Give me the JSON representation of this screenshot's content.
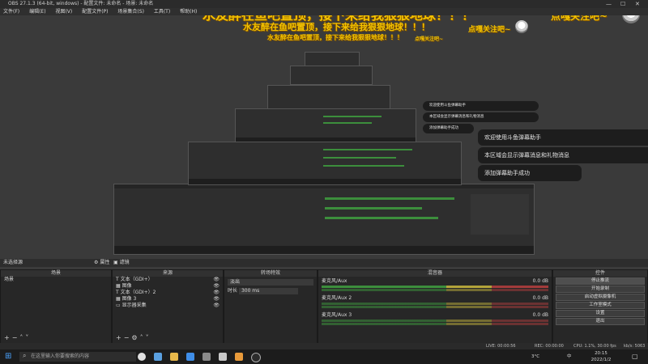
{
  "window": {
    "title": "OBS 27.1.3 (64-bit, windows) - 配置文件: 未命名 - 场景: 未命名",
    "minimize_glyph": "—",
    "maximize_glyph": "☐",
    "close_glyph": "✕"
  },
  "menu": [
    "文件(F)",
    "编辑(E)",
    "视图(V)",
    "配置文件(P)",
    "场景集合(S)",
    "工具(T)",
    "帮助(H)"
  ],
  "overlay": {
    "banner": "水友醉在鱼吧置顶，接下来给我狠狠地球！！！",
    "follow": "点嘎关注吧~"
  },
  "chat": {
    "messages": [
      "欢迎使用斗鱼弹幕助手",
      "本区域会显示弹幕消息和礼物消息",
      "添加弹幕助手成功"
    ]
  },
  "docks": {
    "context_bar": "未选择源",
    "properties_label": "属性",
    "filters_label": "滤镜"
  },
  "scenes": {
    "title": "场景",
    "items": [
      "场景"
    ]
  },
  "sources": {
    "title": "来源",
    "items": [
      {
        "name": "文本（GDI+）",
        "type": "text"
      },
      {
        "name": "图像",
        "type": "image"
      },
      {
        "name": "文本（GDI+）2",
        "type": "text"
      },
      {
        "name": "图像 3",
        "type": "image"
      },
      {
        "name": "显示器采集",
        "type": "monitor"
      }
    ]
  },
  "transitions": {
    "title": "转场特效",
    "selected": "淡出",
    "duration_label": "时长",
    "duration_value": "300 ms"
  },
  "mixer": {
    "title": "混音器",
    "channels": [
      {
        "name": "麦克风/Aux",
        "db": "0.0 dB"
      },
      {
        "name": "麦克风/Aux 2",
        "db": "0.0 dB"
      },
      {
        "name": "麦克风/Aux 3",
        "db": "0.0 dB"
      }
    ]
  },
  "controls": {
    "title": "控件",
    "buttons": [
      "停止推流",
      "开始录制",
      "启动虚拟摄像机",
      "工作室模式",
      "设置",
      "退出"
    ]
  },
  "status": {
    "live": "LIVE: 00:00:56",
    "rec": "REC: 00:00:00",
    "cpu": "CPU: 1.1%, 30.00 fps",
    "kbps": "kb/s: 5063"
  },
  "taskbar": {
    "search_placeholder": "在这里输入你要搜索的内容",
    "tray_lang": "中",
    "time": "20:15",
    "date": "2022/1/2",
    "tray_temp": "3°C"
  },
  "colors": {
    "accent": "#365e8f",
    "banner": "#f2c200",
    "meter_green": "#3c8e3c"
  }
}
